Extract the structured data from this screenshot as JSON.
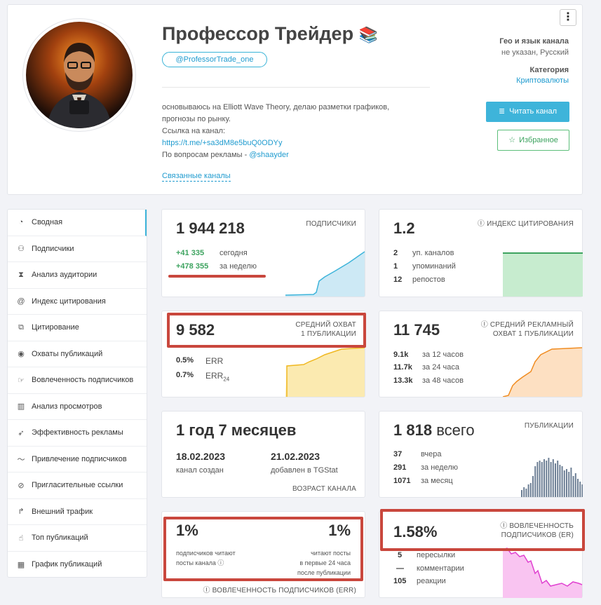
{
  "channel": {
    "title": "Профессор Трейдер",
    "title_emoji": "📚",
    "handle": "@ProfessorTrade_one",
    "desc_line1": "основываюсь на Elliott Wave Theory, делаю разметки графиков,",
    "desc_line2": "прогнозы по рынку.",
    "desc_line3": "Ссылка на канал:",
    "desc_link": "https://t.me/+sa3dM8e5buQ0ODYy",
    "desc_ads": "По вопросам рекламы - ",
    "desc_ads_link": "@shaayder",
    "related": "Связанные каналы",
    "geo_label": "Гео и язык канала",
    "geo_value": "не указан, Русский",
    "category_label": "Категория",
    "category_value": "Криптовалюты",
    "read_button": "Читать канал",
    "fav_button": "Избранное",
    "menu_glyph": "⋮"
  },
  "sidebar": {
    "items": [
      {
        "label": "Сводная",
        "icon": "dashboard-icon",
        "glyph": "◔"
      },
      {
        "label": "Подписчики",
        "icon": "users-icon",
        "glyph": "⚇"
      },
      {
        "label": "Анализ аудитории",
        "icon": "hourglass-icon",
        "glyph": "⧗"
      },
      {
        "label": "Индекс цитирования",
        "icon": "at-icon",
        "glyph": "@"
      },
      {
        "label": "Цитирование",
        "icon": "quote-icon",
        "glyph": "⧉"
      },
      {
        "label": "Охваты публикаций",
        "icon": "eye-icon",
        "glyph": "◉"
      },
      {
        "label": "Вовлеченность подписчиков",
        "icon": "engagement-icon",
        "glyph": "☞"
      },
      {
        "label": "Анализ просмотров",
        "icon": "bar-chart-icon",
        "glyph": "▥"
      },
      {
        "label": "Эффективность рекламы",
        "icon": "rocket-icon",
        "glyph": "➶"
      },
      {
        "label": "Привлечение подписчиков",
        "icon": "trend-icon",
        "glyph": "〜"
      },
      {
        "label": "Пригласительные ссылки",
        "icon": "link-icon",
        "glyph": "⊘"
      },
      {
        "label": "Внешний трафик",
        "icon": "share-icon",
        "glyph": "↱"
      },
      {
        "label": "Топ публикаций",
        "icon": "thumbs-up-icon",
        "glyph": "☝"
      },
      {
        "label": "График публикаций",
        "icon": "calendar-icon",
        "glyph": "▦"
      }
    ]
  },
  "subscribers": {
    "value": "1 944 218",
    "header": "ПОДПИСЧИКИ",
    "today_value": "+41 335",
    "today_label": "сегодня",
    "week_value": "+478 355",
    "week_label": "за неделю"
  },
  "citation": {
    "value": "1.2",
    "header": "ИНДЕКС ЦИТИРОВАНИЯ",
    "rows": [
      {
        "value": "2",
        "label": "уп. каналов"
      },
      {
        "value": "1",
        "label": "упоминаний"
      },
      {
        "value": "12",
        "label": "репостов"
      }
    ]
  },
  "reach": {
    "value": "9 582",
    "header1": "СРЕДНИЙ ОХВАТ",
    "header2": "1 ПУБЛИКАЦИИ",
    "err_value": "0.5%",
    "err_label": "ERR",
    "err24_value": "0.7%",
    "err24_label": "ERR",
    "err24_sub": "24"
  },
  "ad_reach": {
    "value": "11 745",
    "header1": "СРЕДНИЙ РЕКЛАМНЫЙ",
    "header2": "ОХВАТ 1 ПУБЛИКАЦИИ",
    "rows": [
      {
        "value": "9.1k",
        "label": "за 12 часов"
      },
      {
        "value": "11.7k",
        "label": "за 24 часа"
      },
      {
        "value": "13.3k",
        "label": "за 48 часов"
      }
    ]
  },
  "age": {
    "value": "1 год 7 месяцев",
    "created_date": "18.02.2023",
    "created_label": "канал создан",
    "added_date": "21.02.2023",
    "added_label": "добавлен в TGStat",
    "footer": "ВОЗРАСТ КАНАЛА"
  },
  "posts": {
    "value": "1 818",
    "value_suffix": "всего",
    "header": "ПУБЛИКАЦИИ",
    "rows": [
      {
        "value": "37",
        "label": "вчера"
      },
      {
        "value": "291",
        "label": "за неделю"
      },
      {
        "value": "1071",
        "label": "за месяц"
      }
    ]
  },
  "err_card": {
    "left_value": "1%",
    "right_value": "1%",
    "left_label1": "подписчиков читают",
    "left_label2": "посты канала",
    "right_label1": "читают посты",
    "right_label2": "в первые 24 часа",
    "right_label3": "после публикации",
    "footer": "ВОВЛЕЧЕННОСТЬ ПОДПИСЧИКОВ (ERR)"
  },
  "er_card": {
    "value": "1.58%",
    "header1": "ВОВЛЕЧЕННОСТЬ",
    "header2": "ПОДПИСЧИКОВ (ER)",
    "rows": [
      {
        "value": "5",
        "label": "пересылки"
      },
      {
        "value": "—",
        "label": "комментарии"
      },
      {
        "value": "105",
        "label": "реакции"
      }
    ]
  },
  "icons": {
    "info": "ⓘ",
    "list": "≣",
    "star": "☆"
  },
  "colors": {
    "accent": "#3eb4da",
    "green": "#3da35f",
    "highlight": "#c9473d"
  }
}
